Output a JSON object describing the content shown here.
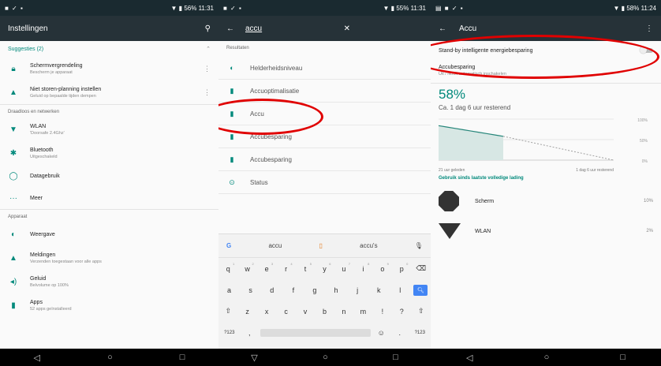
{
  "panel1": {
    "status_time": "11:31",
    "status_battery": "56%",
    "title": "Instellingen",
    "suggestions_label": "Suggesties (2)",
    "suggestions": [
      {
        "title": "Schermvergrendeling",
        "subtitle": "Bescherm je apparaat"
      },
      {
        "title": "Niet storen-planning instellen",
        "subtitle": "Geluid op bepaalde tijden dempen"
      }
    ],
    "section_wireless": "Draadloos en netwerken",
    "wireless_items": [
      {
        "title": "WLAN",
        "subtitle": "'Doorsafe 2.4Ghz'",
        "icon": "wifi-icon"
      },
      {
        "title": "Bluetooth",
        "subtitle": "Uitgeschakeld",
        "icon": "bluetooth-icon"
      },
      {
        "title": "Datagebruik",
        "subtitle": "",
        "icon": "data-usage-icon"
      },
      {
        "title": "Meer",
        "subtitle": "",
        "icon": "more-icon"
      }
    ],
    "section_device": "Apparaat",
    "device_items": [
      {
        "title": "Weergave",
        "subtitle": "",
        "icon": "display-icon"
      },
      {
        "title": "Meldingen",
        "subtitle": "Verzenden toegestaan voor alle apps",
        "icon": "notification-icon"
      },
      {
        "title": "Geluid",
        "subtitle": "Belvolume op 100%",
        "icon": "sound-icon"
      },
      {
        "title": "Apps",
        "subtitle": "52 apps geïnstalleerd",
        "icon": "apps-icon"
      }
    ]
  },
  "panel2": {
    "status_time": "11:31",
    "status_battery": "55%",
    "query": "accu",
    "results_label": "Resultaten",
    "results": [
      {
        "label": "Helderheidsniveau",
        "icon": "brightness-icon"
      },
      {
        "label": "Accuoptimalisatie",
        "icon": "battery-icon"
      },
      {
        "label": "Accu",
        "icon": "battery-icon"
      },
      {
        "label": "Accubesparing",
        "icon": "battery-icon"
      },
      {
        "label": "Accubesparing",
        "icon": "battery-icon"
      },
      {
        "label": "Status",
        "icon": "status-icon"
      }
    ],
    "keyboard": {
      "suggestions": [
        "accu",
        "accu's"
      ],
      "row1": [
        "q",
        "w",
        "e",
        "r",
        "t",
        "y",
        "u",
        "i",
        "o",
        "p"
      ],
      "row1_nums": [
        "1",
        "2",
        "3",
        "4",
        "5",
        "6",
        "7",
        "8",
        "9",
        "0"
      ],
      "row2": [
        "a",
        "s",
        "d",
        "f",
        "g",
        "h",
        "j",
        "k",
        "l"
      ],
      "row3": [
        "z",
        "x",
        "c",
        "v",
        "b",
        "n",
        "m",
        "!",
        "?"
      ],
      "sym_key": "?123",
      "comma_key": ",",
      "period_key": "."
    }
  },
  "panel3": {
    "status_time": "11:24",
    "status_battery": "58%",
    "title": "Accu",
    "standby_label": "Stand-by intelligente energiebesparing",
    "saver_title": "Accubesparing",
    "saver_subtitle": "Uit / Nooit automatisch inschakelen",
    "percent": "58%",
    "remaining": "Ca. 1 dag 6 uur resterend",
    "chart_y_labels": [
      "100%",
      "50%",
      "0%"
    ],
    "chart_x_left": "21 uur geleden",
    "chart_x_right": "1 dag 6 uur resterend",
    "usage_link": "Gebruik sinds laatste volledige lading",
    "usage": [
      {
        "label": "Scherm",
        "value": "10%",
        "icon": "screen-icon"
      },
      {
        "label": "WLAN",
        "value": "2%",
        "icon": "wifi-icon"
      }
    ],
    "battery_level_fraction": 0.58
  },
  "colors": {
    "accent": "#00897b",
    "appbar": "#263238",
    "highlight": "#e00000"
  }
}
